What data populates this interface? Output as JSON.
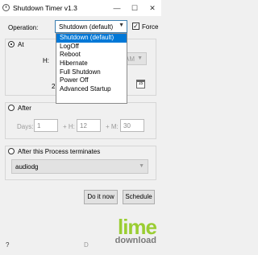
{
  "window": {
    "title": "Shutdown Timer v1.3",
    "minimize": "—",
    "maximize": "☐",
    "close": "✕"
  },
  "operation": {
    "label": "Operation:",
    "selected": "Shutdown (default)",
    "force_checked": true,
    "force_label": "Force",
    "options": [
      "Shutdown (default)",
      "LogOff",
      "Reboot",
      "Hibernate",
      "Full Shutdown",
      "Power Off",
      "Advanced Startup"
    ]
  },
  "at": {
    "title": "At",
    "selected": true,
    "hour_label": "H:",
    "ampm_partial": "AM",
    "date_prefix": "2",
    "calendar_icon_text": "15"
  },
  "after": {
    "title": "After",
    "selected": false,
    "days_label": "Days:",
    "days_value": "1",
    "hours_label": "+ H:",
    "hours_value": "12",
    "minutes_label": "+ M:",
    "minutes_value": "30"
  },
  "process": {
    "title": "After this Process terminates",
    "selected": false,
    "value": "audiodg"
  },
  "buttons": {
    "do_it_now": "Do it now",
    "schedule": "Schedule"
  },
  "bottom": {
    "help": "?",
    "partial_text": "D"
  },
  "watermark": {
    "line1": "lime",
    "line2": "download"
  },
  "colors": {
    "accent": "#0078d7",
    "watermark_green": "#9acd32",
    "window_bg": "#f0f0f0"
  }
}
